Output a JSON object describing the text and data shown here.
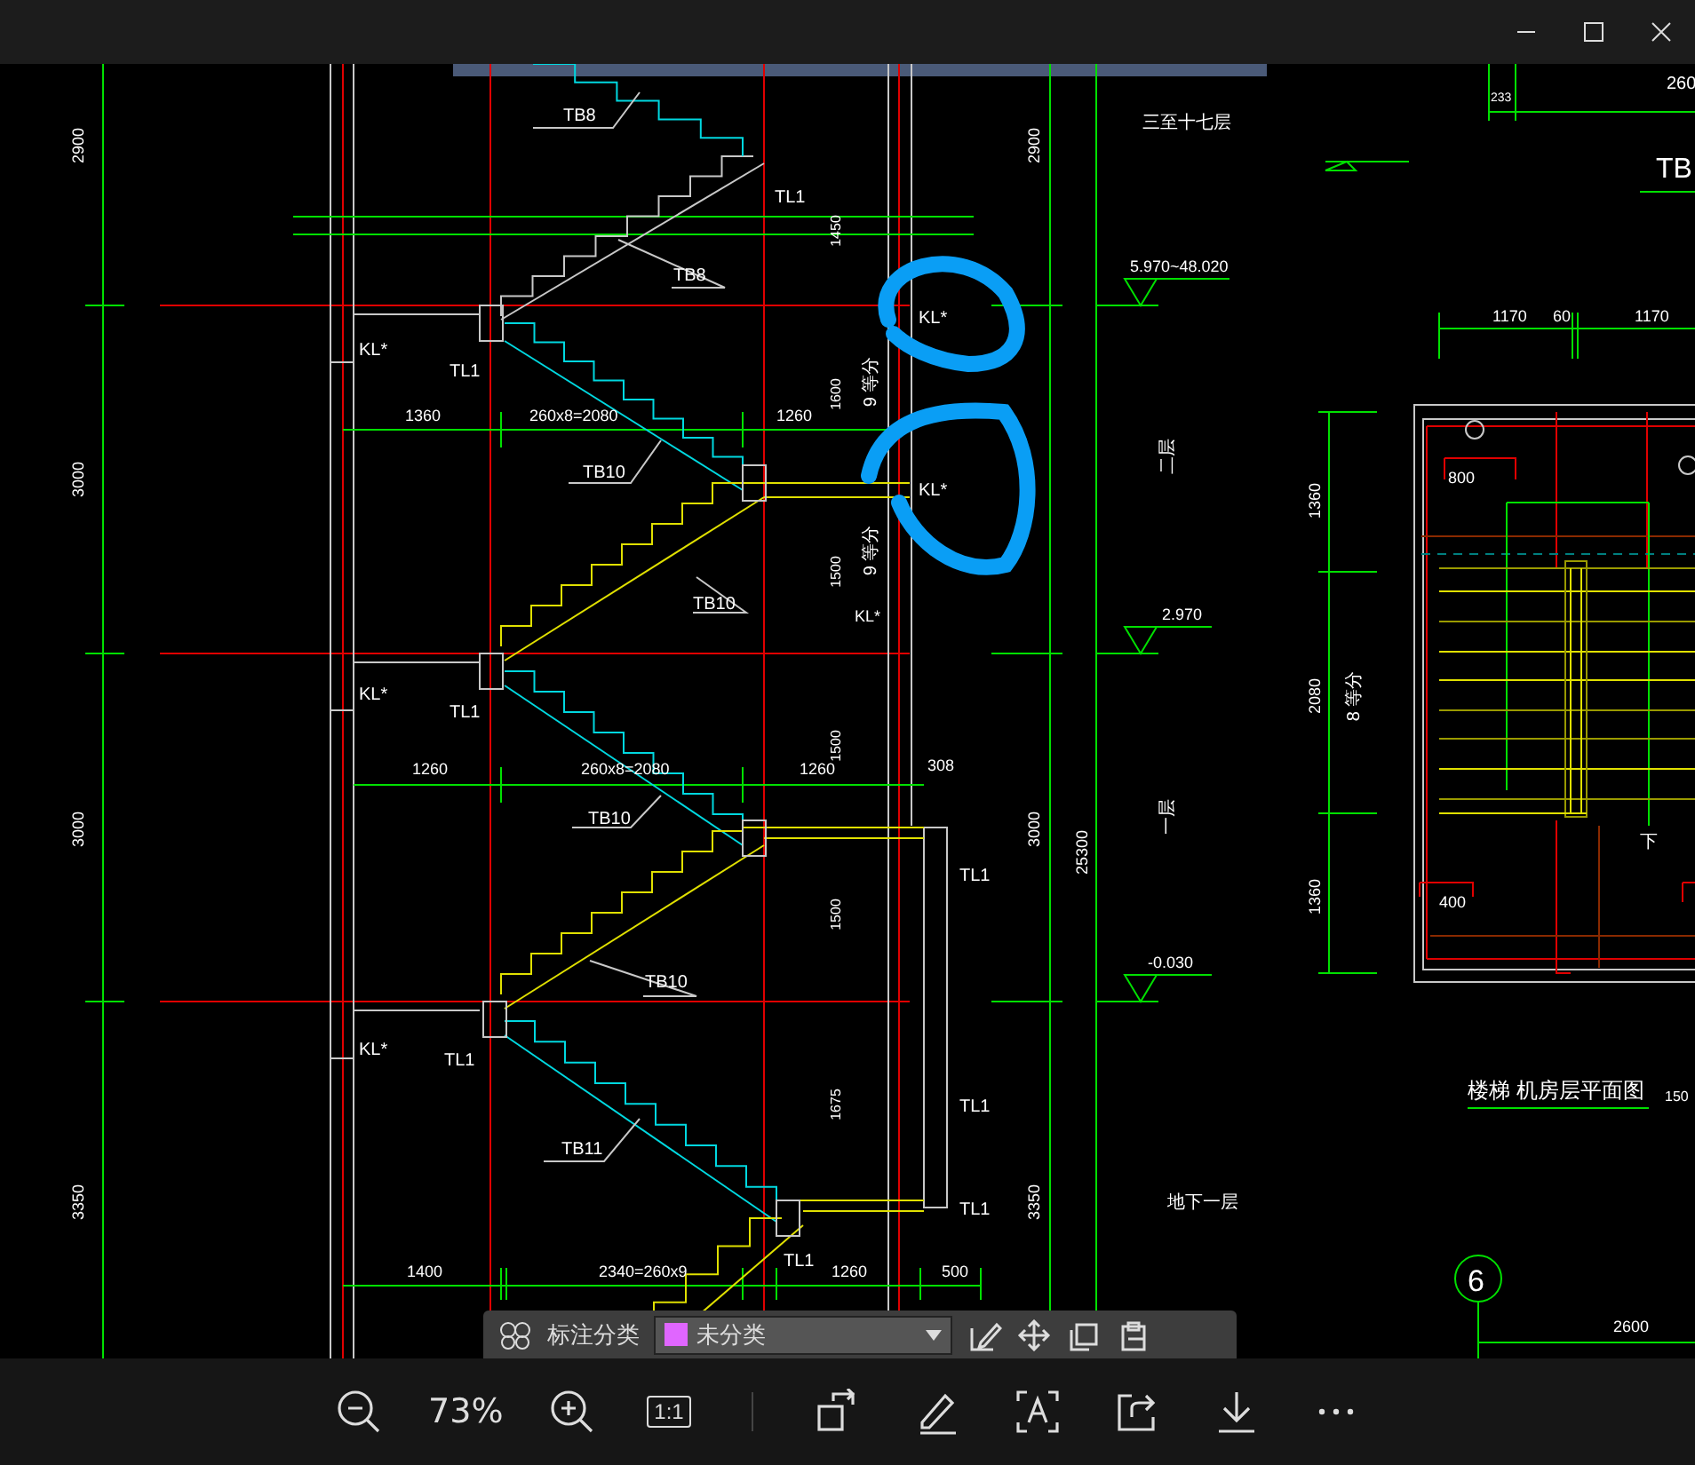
{
  "cad_view": {
    "labels": [
      {
        "text": "2900"
      },
      {
        "text": "3000"
      },
      {
        "text": "3000"
      },
      {
        "text": "3350"
      },
      {
        "text": "TB8"
      },
      {
        "text": "TL1"
      },
      {
        "text": "TB8"
      },
      {
        "text": "KL*"
      },
      {
        "text": "TL1"
      },
      {
        "text": "1360"
      },
      {
        "text": "260x8=2080"
      },
      {
        "text": "1260"
      },
      {
        "text": "TB10"
      },
      {
        "text": "TB10"
      },
      {
        "text": "KL*"
      },
      {
        "text": "TL1"
      },
      {
        "text": "1260"
      },
      {
        "text": "260x8=2080"
      },
      {
        "text": "1260"
      },
      {
        "text": "308"
      },
      {
        "text": "TB10"
      },
      {
        "text": "TB10"
      },
      {
        "text": "KL*"
      },
      {
        "text": "TL1"
      },
      {
        "text": "TB11"
      },
      {
        "text": "TL1"
      },
      {
        "text": "TL1"
      },
      {
        "text": "TL1"
      },
      {
        "text": "1400"
      },
      {
        "text": "2340=260x9"
      },
      {
        "text": "TL1"
      },
      {
        "text": "1260"
      },
      {
        "text": "500"
      },
      {
        "text": "1450"
      },
      {
        "text": "1600"
      },
      {
        "text": "1500"
      },
      {
        "text": "1500"
      },
      {
        "text": "1500"
      },
      {
        "text": "1675"
      },
      {
        "text": "9 等分"
      },
      {
        "text": "9 等分"
      },
      {
        "text": "KL*"
      },
      {
        "text": "KL*"
      },
      {
        "text": "KL*"
      },
      {
        "text": "2900"
      },
      {
        "text": "3000"
      },
      {
        "text": "25300"
      },
      {
        "text": "3350"
      },
      {
        "text": "三至十七层"
      },
      {
        "text": "5.970~48.020"
      },
      {
        "text": "二层"
      },
      {
        "text": "2.970"
      },
      {
        "text": "一层"
      },
      {
        "text": "-0.030"
      },
      {
        "text": "地下一层"
      },
      {
        "text": "233"
      },
      {
        "text": "260"
      },
      {
        "text": "TB"
      },
      {
        "text": "1170"
      },
      {
        "text": "60"
      },
      {
        "text": "1170"
      },
      {
        "text": "1360"
      },
      {
        "text": "2080"
      },
      {
        "text": "8 等分"
      },
      {
        "text": "1360"
      },
      {
        "text": "800"
      },
      {
        "text": "400"
      },
      {
        "text": "下"
      },
      {
        "text": "楼梯 机房层平面图"
      },
      {
        "text": "150"
      },
      {
        "text": "6"
      },
      {
        "text": "2600"
      }
    ]
  },
  "cad_toolbar": {
    "label": "标注分类",
    "category": "未分类"
  },
  "viewer_toolbar": {
    "zoom": "73%",
    "actual_size": "1:1"
  }
}
